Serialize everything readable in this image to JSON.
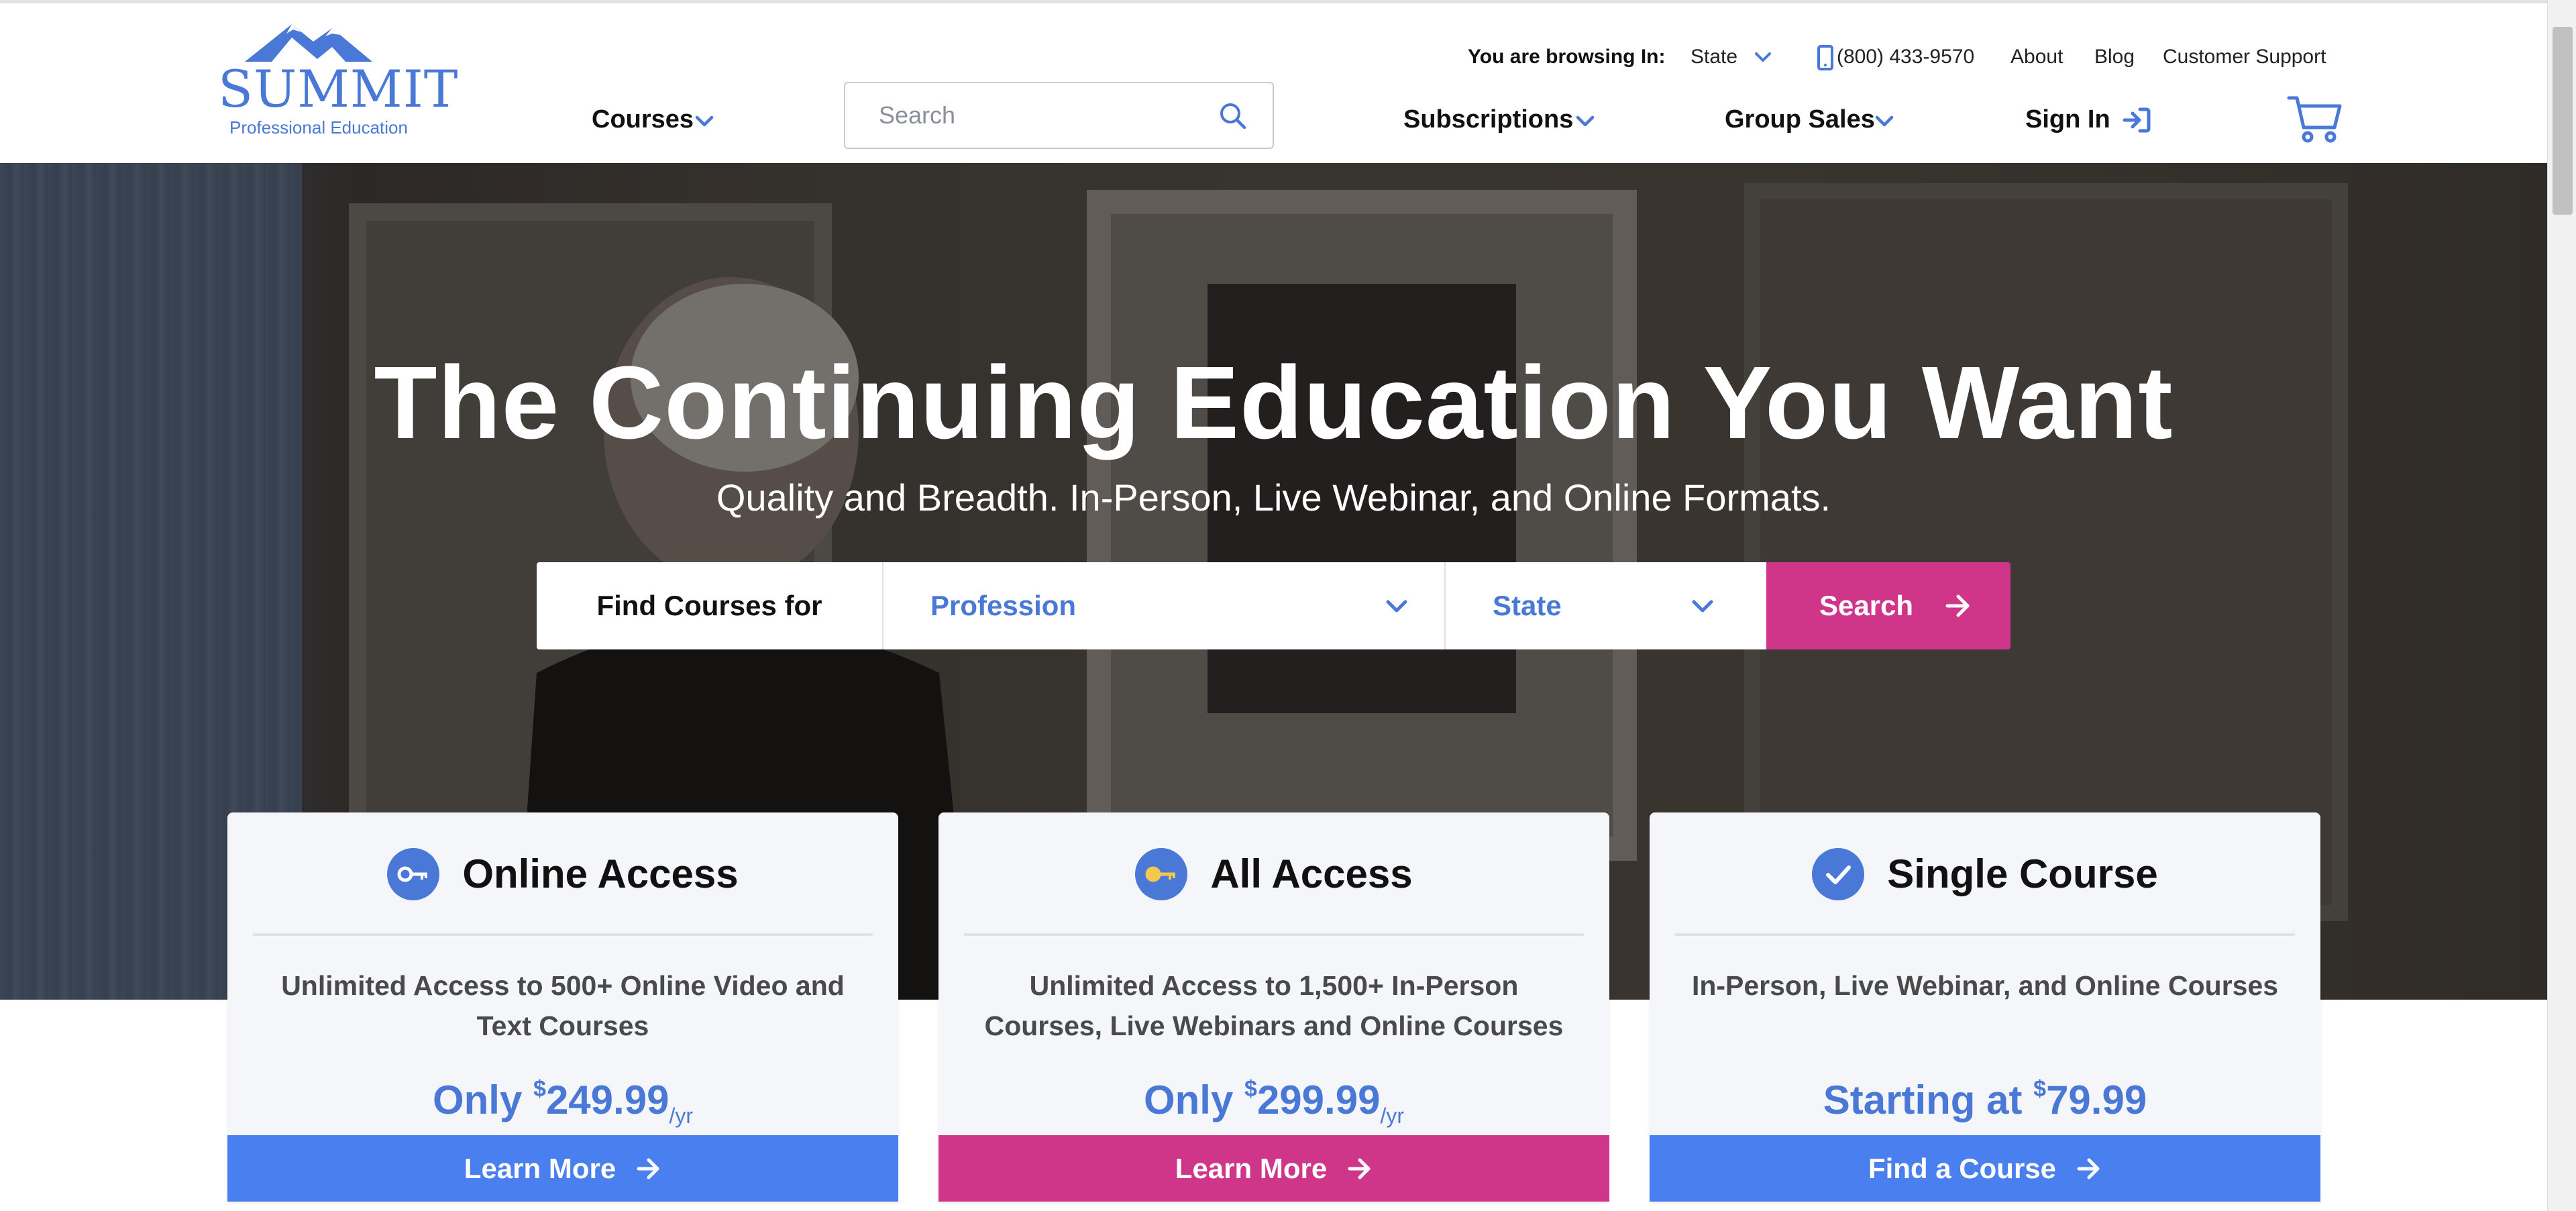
{
  "logo": {
    "wordmark": "SUMMIT",
    "tagline": "Professional Education"
  },
  "utility_bar": {
    "browsing_label": "You are browsing In:",
    "state_value": "State",
    "phone": "(800) 433-9570",
    "about": "About",
    "blog": "Blog",
    "support": "Customer Support"
  },
  "nav": {
    "courses": "Courses",
    "subscriptions": "Subscriptions",
    "group_sales": "Group Sales",
    "sign_in": "Sign In"
  },
  "search": {
    "placeholder": "Search"
  },
  "hero": {
    "title": "The Continuing Education You Want",
    "subtitle": "Quality and Breadth. In-Person, Live Webinar, and Online Formats."
  },
  "finder": {
    "label": "Find Courses for",
    "profession": "Profession",
    "state": "State",
    "button": "Search"
  },
  "cards": [
    {
      "title": "Online Access",
      "icon": "key-icon",
      "description": "Unlimited Access to 500+ Online Video and Text Courses",
      "price_prefix": "Only",
      "currency": "$",
      "price": "249.99",
      "period": "/yr",
      "button": "Learn More"
    },
    {
      "title": "All Access",
      "icon": "key-icon",
      "description": "Unlimited Access to 1,500+ In-Person Courses, Live Webinars and Online Courses",
      "price_prefix": "Only",
      "currency": "$",
      "price": "299.99",
      "period": "/yr",
      "button": "Learn More"
    },
    {
      "title": "Single Course",
      "icon": "checkmark-icon",
      "description": "In-Person, Live Webinar, and Online Courses",
      "price_prefix": "Starting at",
      "currency": "$",
      "price": "79.99",
      "button": "Find a Course"
    }
  ],
  "colors": {
    "brand_blue": "#4a78d6",
    "button_blue": "#4a7ff0",
    "accent_pink": "#cf3588",
    "card_bg": "#f4f6fa"
  }
}
